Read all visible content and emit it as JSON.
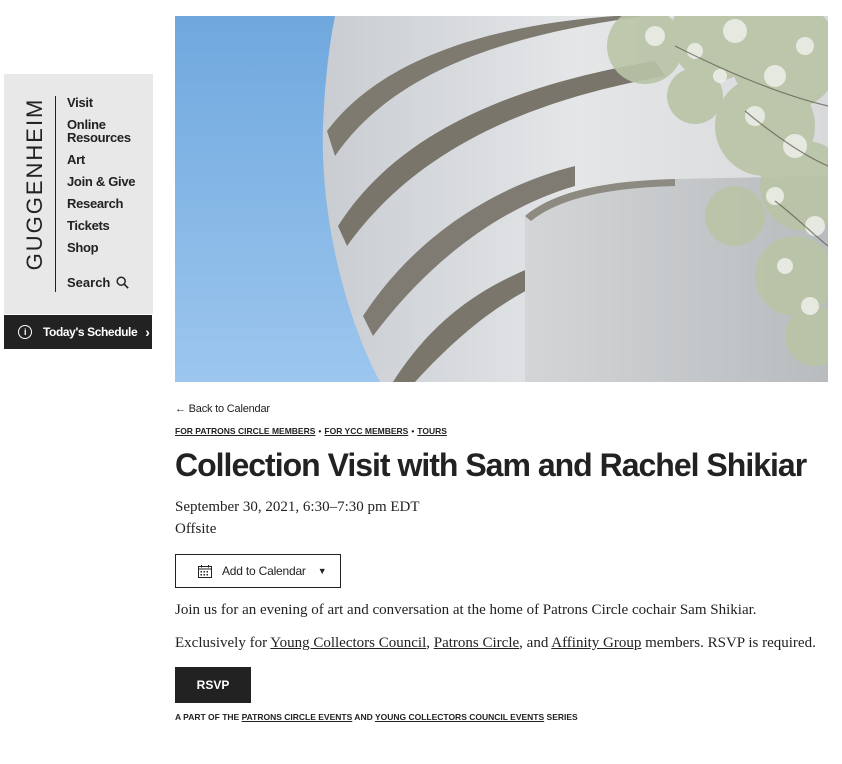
{
  "sidebar": {
    "logo": "GUGGENHEIM",
    "nav": [
      {
        "label": "Visit"
      },
      {
        "label": "Online Resources"
      },
      {
        "label": "Art"
      },
      {
        "label": "Join & Give"
      },
      {
        "label": "Research"
      },
      {
        "label": "Tickets"
      },
      {
        "label": "Shop"
      }
    ],
    "search_label": "Search",
    "schedule_label": "Today's Schedule"
  },
  "event": {
    "back_label": "← Back to Calendar",
    "tags": [
      "FOR PATRONS CIRCLE MEMBERS",
      "FOR YCC MEMBERS",
      "TOURS"
    ],
    "title": "Collection Visit with Sam and Rachel Shikiar",
    "date": "September 30, 2021, 6:30–7:30 pm EDT",
    "location": "Offsite",
    "add_to_calendar": "Add to Calendar",
    "description": "Join us for an evening of art and conversation at the home of Patrons Circle cochair Sam Shikiar.",
    "eligibility": {
      "prefix": "Exclusively for ",
      "link1": "Young Collectors Council",
      "sep1": ", ",
      "link2": "Patrons Circle",
      "sep2": ", and ",
      "link3": "Affinity Group",
      "suffix": " members. RSVP is required."
    },
    "rsvp_label": "RSVP",
    "series": {
      "prefix": "A PART OF THE ",
      "link1": "PATRONS CIRCLE EVENTS",
      "and": " AND ",
      "link2": "YOUNG COLLECTORS COUNCIL EVENTS",
      "suffix": " SERIES"
    }
  }
}
